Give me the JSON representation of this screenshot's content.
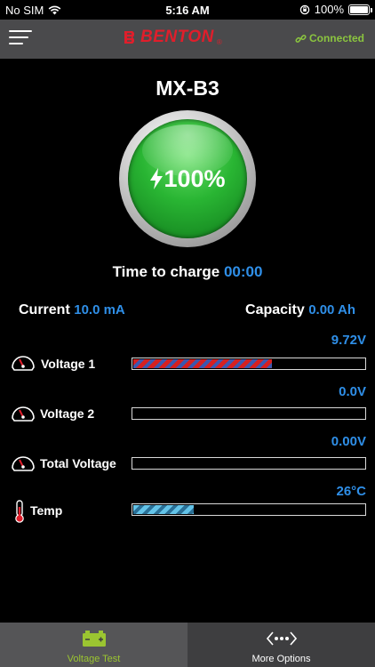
{
  "status_bar": {
    "carrier": "No SIM",
    "time": "5:16 AM",
    "battery": "100%",
    "battery_level": 1.0
  },
  "header": {
    "brand": "BENTON",
    "brand_mark": "®",
    "connection": "Connected"
  },
  "device": {
    "name": "MX-B3",
    "charge_percent": "100%"
  },
  "charge_info": {
    "time_label": "Time to charge",
    "time_value": "00:00"
  },
  "readings": {
    "current_label": "Current",
    "current_value": "10.0 mA",
    "capacity_label": "Capacity",
    "capacity_value": "0.00 Ah"
  },
  "meters": [
    {
      "label": "Voltage 1",
      "value": "9.72V",
      "level": 0.6,
      "icon": "battery-gauge-icon"
    },
    {
      "label": "Voltage 2",
      "value": "0.0V",
      "level": 0,
      "icon": "battery-gauge-icon"
    },
    {
      "label": "Total Voltage",
      "value": "0.00V",
      "level": 0,
      "icon": "battery-gauge-icon"
    },
    {
      "label": "Temp",
      "value": "26°C",
      "level": 0.26,
      "icon": "thermometer-icon"
    }
  ],
  "tabs": [
    {
      "label": "Voltage Test",
      "active": true,
      "icon": "battery-icon"
    },
    {
      "label": "More Options",
      "active": false,
      "icon": "more-options-icon"
    }
  ],
  "colors": {
    "accent_blue": "#2f8fe8",
    "brand_red": "#e01e2b",
    "connected_green": "#8bc53f",
    "gauge_green": "#29b533"
  }
}
